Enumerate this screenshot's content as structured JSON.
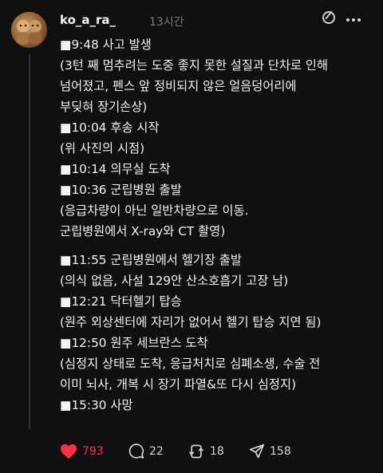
{
  "post": {
    "username": "ko_a_ra_",
    "time": "13시간",
    "lines": [
      "■9:48 사고 발생",
      "(3턴 째 멈추려는 도중 좋지 못한 설질과 단차로 인해",
      "넘어졌고, 펜스 앞 정비되지 않은 얼음덩어리에",
      "부딪혀 장기손상)",
      "■10:04 후송 시작",
      "(위 사진의 시점)",
      "■10:14 의무실 도착",
      "■10:36 군립병원 출발",
      "(응급차량이 아닌 일반차량으로 이동.",
      "군립병원에서 X-ray와 CT 촬영)",
      "■11:55 군립병원에서 헬기장 출발",
      "(의식 없음, 사설 129안 산소호흡기 고장 남)",
      "■12:21 닥터헬기 탑승",
      "(원주 외상센터에 자리가 없어서 헬기 탑승 지연 됨)",
      "■12:50 원주 세브란스 도착",
      "(심정지 상태로 도착, 응급처치로 심폐소생, 수술 전",
      "이미 뇌사, 개복 시 장기 파열&또 다시 심정지)",
      "■15:30 사망"
    ]
  },
  "actions": {
    "likes": "793",
    "comments": "22",
    "reposts": "18",
    "shares": "158"
  },
  "colors": {
    "background": "#101010",
    "like": "#ff3040"
  }
}
